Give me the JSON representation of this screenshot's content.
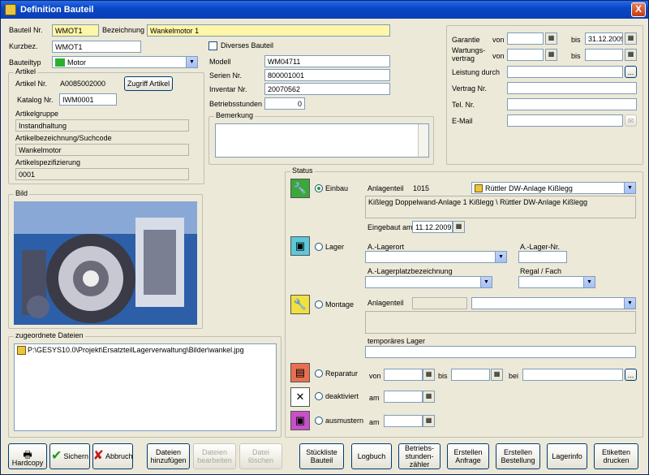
{
  "window": {
    "title": "Definition Bauteil",
    "close": "X"
  },
  "header": {
    "bauteil_nr_label": "Bauteil Nr.",
    "bauteil_nr": "WMOT1",
    "bezeichnung_label": "Bezeichnung",
    "bezeichnung": "Wankelmotor 1",
    "kurzbez_label": "Kurzbez.",
    "kurzbez": "WMOT1",
    "bauteiltyp_label": "Bauteiltyp",
    "bauteiltyp": "Motor"
  },
  "artikel": {
    "group": "Artikel",
    "artikel_nr_label": "Artikel Nr.",
    "artikel_nr": "A0085002000",
    "zugriff_button": "Zugriff Artikel",
    "katalog_nr_label": "Katalog Nr.",
    "katalog_nr": "IWM0001",
    "artikelgruppe_label": "Artikelgruppe",
    "artikelgruppe": "Instandhaltung",
    "suchcode_label": "Artikelbezeichnung/Suchcode",
    "suchcode": "Wankelmotor",
    "spez_label": "Artikelspezifizierung",
    "spez": "0001"
  },
  "details": {
    "diverses_label": "Diverses Bauteil",
    "modell_label": "Modell",
    "modell": "WM04711",
    "serien_label": "Serien Nr.",
    "serien": "800001001",
    "inventar_label": "Inventar Nr.",
    "inventar": "20070562",
    "betrieb_label": "Betriebsstunden",
    "betrieb": "0",
    "bemerkung_label": "Bemerkung"
  },
  "garantie": {
    "garantie_label": "Garantie",
    "von_label": "von",
    "bis_label": "bis",
    "garantie_bis": "31.12.2009",
    "wartung_label": "Wartungs-\nvertrag",
    "leistung_label": "Leistung durch",
    "leistung_btn": "...",
    "vertrag_label": "Vertrag Nr.",
    "tel_label": "Tel. Nr.",
    "email_label": "E-Mail"
  },
  "bild": {
    "group": "Bild"
  },
  "dateien": {
    "group": "zugeordnete Dateien",
    "file": "P:\\GESYS10.0\\Projekt\\ErsatzteilLagerverwaltung\\Bilder\\wankel.jpg"
  },
  "status": {
    "group": "Status",
    "einbau_label": "Einbau",
    "anlagenteil_label": "Anlagenteil",
    "anlagenteil_nr": "1015",
    "anlagenteil_name": "Rüttler DW-Anlage Kißlegg",
    "anlage_path": "Kißlegg Doppelwand-Anlage 1 Kißlegg \\ Rüttler DW-Anlage Kißlegg",
    "eingebaut_label": "Eingebaut am",
    "eingebaut": "11.12.2009",
    "lager_label": "Lager",
    "lagerort_label": "A.-Lagerort",
    "lagernr_label": "A.-Lager-Nr.",
    "lagerplatz_label": "A.-Lagerplatzbezeichnung",
    "regal_label": "Regal / Fach",
    "montage_label": "Montage",
    "montage_anlagenteil_label": "Anlagenteil",
    "temp_lager_label": "temporäres Lager",
    "reparatur_label": "Reparatur",
    "von_label": "von",
    "bis_label": "bis",
    "bei_label": "bei",
    "bei_btn": "...",
    "deaktiviert_label": "deaktiviert",
    "am_label": "am",
    "ausmustern_label": "ausmustern",
    "am2_label": "am"
  },
  "toolbar": {
    "hardcopy": "Hardcopy",
    "sichern": "Sichern",
    "abbruch": "Abbruch",
    "dateien_hinzu": "Dateien\nhinzufügen",
    "dateien_bearb": "Dateien\nbearbeiten",
    "datei_loeschen": "Datei\nlöschen",
    "stueckliste": "Stückliste\nBauteil",
    "logbuch": "Logbuch",
    "betriebszaehler": "Betriebs-\nstunden-\nzähler",
    "anfrage": "Erstellen\nAnfrage",
    "bestellung": "Erstellen\nBestellung",
    "lagerinfo": "Lagerinfo",
    "etiketten": "Etiketten\ndrucken"
  }
}
